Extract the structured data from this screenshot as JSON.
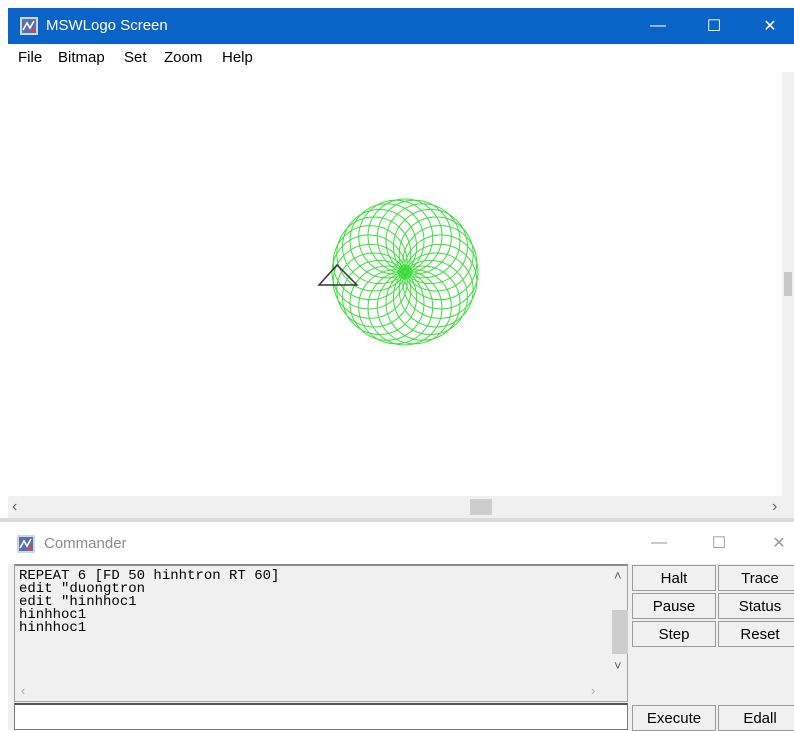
{
  "window": {
    "title": "MSWLogo Screen",
    "minimize": "—",
    "maximize": "☐",
    "close": "✕"
  },
  "menu": {
    "items": [
      {
        "label": "File"
      },
      {
        "label": "Bitmap"
      },
      {
        "label": "Set"
      },
      {
        "label": "Zoom"
      },
      {
        "label": "Help"
      }
    ]
  },
  "canvas": {
    "drawing_color": "#3cdc3c",
    "turtle_color": "#333333"
  },
  "scroll": {
    "left_arrow": "‹",
    "right_arrow": "›",
    "up_arrow": "˄",
    "down_arrow": "˅"
  },
  "commander": {
    "title": "Commander",
    "minimize": "—",
    "maximize": "☐",
    "close": "✕",
    "history": [
      "REPEAT 6 [FD 50 hinhtron RT 60]",
      "edit \"duongtron",
      "edit \"hinhhoc1",
      "hinhhoc1",
      "hinhhoc1"
    ],
    "input_value": "",
    "buttons": {
      "halt": "Halt",
      "trace": "Trace",
      "pause": "Pause",
      "status": "Status",
      "step": "Step",
      "reset": "Reset",
      "execute": "Execute",
      "edall": "Edall"
    }
  },
  "colors": {
    "titlebar": "#0a64c8",
    "accent": "#3cdc3c"
  }
}
